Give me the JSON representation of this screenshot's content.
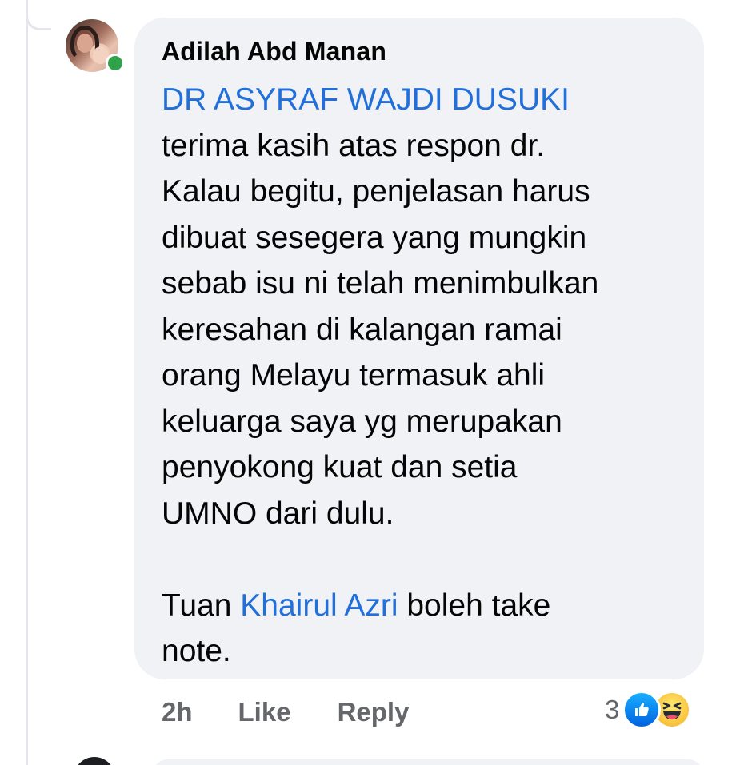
{
  "comment": {
    "author": "Adilah Abd Manan",
    "mention_top": "DR ASYRAF WAJDI DUSUKI",
    "lines": [
      "terima kasih atas respon dr.",
      "Kalau begitu, penjelasan harus",
      "dibuat sesegera yang mungkin",
      "sebab isu ni telah menimbulkan",
      "keresahan di kalangan ramai",
      "orang Melayu termasuk ahli",
      "keluarga saya yg merupakan",
      "penyokong kuat dan setia",
      "UMNO dari dulu."
    ],
    "tail_prefix": "Tuan ",
    "tail_mention": "Khairul Azri",
    "tail_suffix": " boleh take",
    "tail_last": "note.",
    "time": "2h",
    "like_label": "Like",
    "reply_label": "Reply",
    "reaction_count": "3",
    "reactions": [
      "like-icon",
      "haha-icon"
    ],
    "online": true
  },
  "colors": {
    "bubble": "#f0f2f5",
    "mention": "#216fdb",
    "meta_text": "#65676b",
    "online": "#31a24c"
  }
}
